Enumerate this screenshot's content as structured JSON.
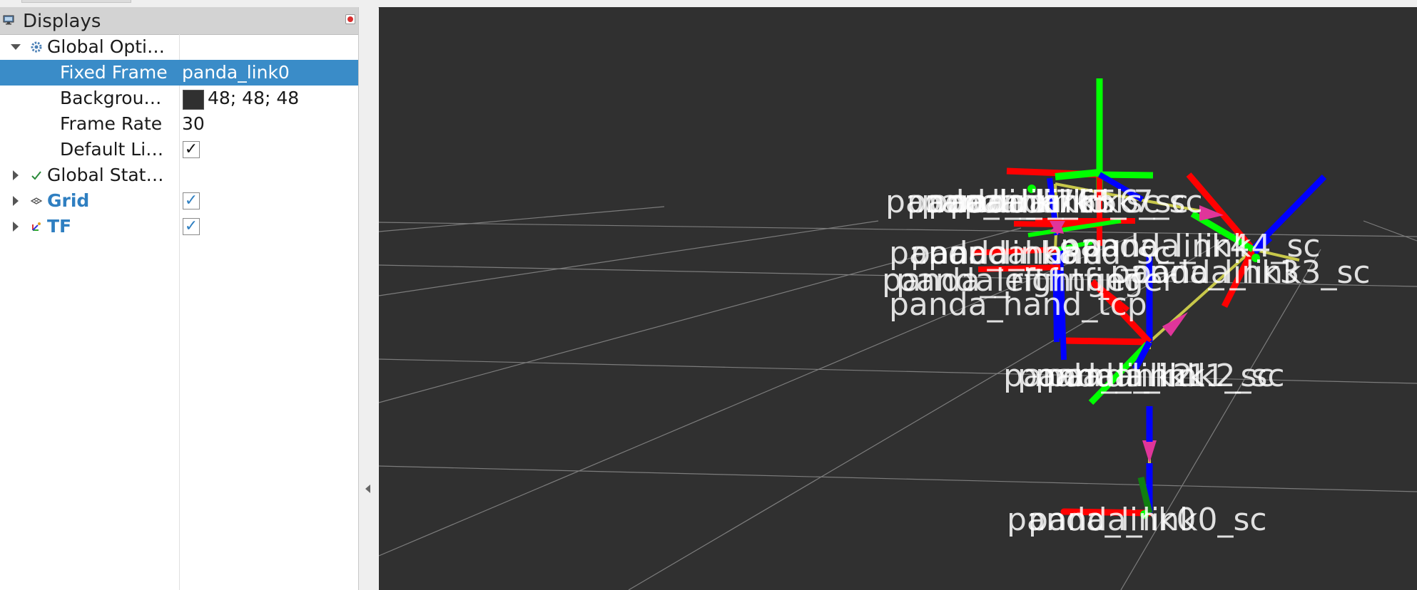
{
  "panel": {
    "title": "Displays",
    "icon": "monitor-icon",
    "close_icon": "close-icon"
  },
  "tree": {
    "global_options": {
      "label": "Global Opti…",
      "icon": "gear-icon"
    },
    "fixed_frame": {
      "label": "Fixed Frame",
      "value": "panda_link0"
    },
    "background": {
      "label": "Backgrou…",
      "value": "48; 48; 48",
      "swatch_color": "#303030"
    },
    "frame_rate": {
      "label": "Frame Rate",
      "value": "30"
    },
    "default_light": {
      "label": "Default Li…",
      "checked": "✓"
    },
    "global_status": {
      "label": "Global Stat…",
      "icon": "checkmark-icon"
    },
    "grid": {
      "label": "Grid",
      "icon": "grid-icon",
      "checked": "✓"
    },
    "tf": {
      "label": "TF",
      "icon": "tf-icon",
      "checked": "✓"
    }
  },
  "viewport": {
    "background_color": "#303030",
    "frame_labels": [
      "panda_link7",
      "panda_link6",
      "panda_link5_sc",
      "panda_link5",
      "panda_link6_sc",
      "panda_link7_sc",
      "panda_link8",
      "panda_hand",
      "panda_hand_sc",
      "panda_leftfinger",
      "panda_rightfinger",
      "panda_hand_tcp",
      "panda_link4",
      "panda_link4_sc",
      "panda_link3",
      "panda_link3_sc",
      "panda_link2",
      "panda_link1",
      "panda_link1_sc",
      "panda_link2_sc",
      "panda_link0",
      "panda_link0_sc"
    ]
  },
  "colors": {
    "selection": "#3a8cc8",
    "x_axis": "#ff0000",
    "y_axis": "#00ff00",
    "z_axis": "#0000ff",
    "tf_link": "#c8c84a",
    "tf_arrow": "#e0359a"
  }
}
